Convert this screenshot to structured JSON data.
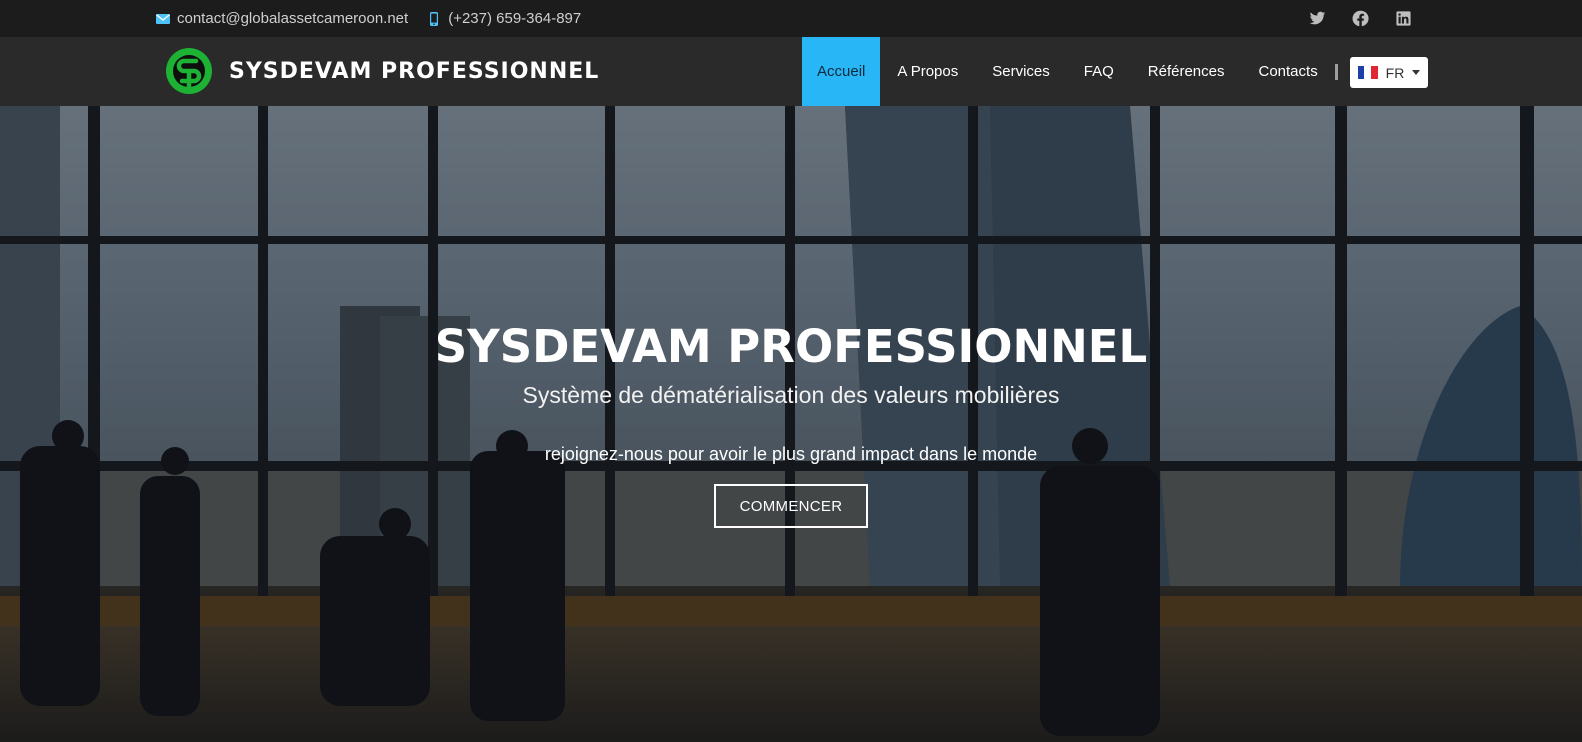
{
  "topbar": {
    "email": "contact@globalassetcameroon.net",
    "phone": "(+237) 659-364-897",
    "icons": {
      "email": "mail-icon",
      "phone": "mobile-phone-icon",
      "social": [
        "twitter-icon",
        "facebook-icon",
        "linkedin-icon"
      ]
    }
  },
  "navbar": {
    "brand": "SYSDEVAM PROFESSIONNEL",
    "menu": [
      {
        "label": "Accueil",
        "active": true
      },
      {
        "label": "A Propos",
        "active": false
      },
      {
        "label": "Services",
        "active": false
      },
      {
        "label": "FAQ",
        "active": false
      },
      {
        "label": "Références",
        "active": false
      },
      {
        "label": "Contacts",
        "active": false
      }
    ],
    "language": "FR"
  },
  "hero": {
    "title": "SYSDEVAM PROFESSIONNEL",
    "subtitle": "Système de dématérialisation des valeurs mobilières",
    "tagline": "rejoignez-nous pour avoir le plus grand impact dans le monde",
    "cta": "COMMENCER"
  },
  "colors": {
    "accent": "#29b6f6",
    "topbar_bg": "#1c1c1c",
    "navbar_bg": "#2a2a2a",
    "logo_green": "#1db233"
  }
}
